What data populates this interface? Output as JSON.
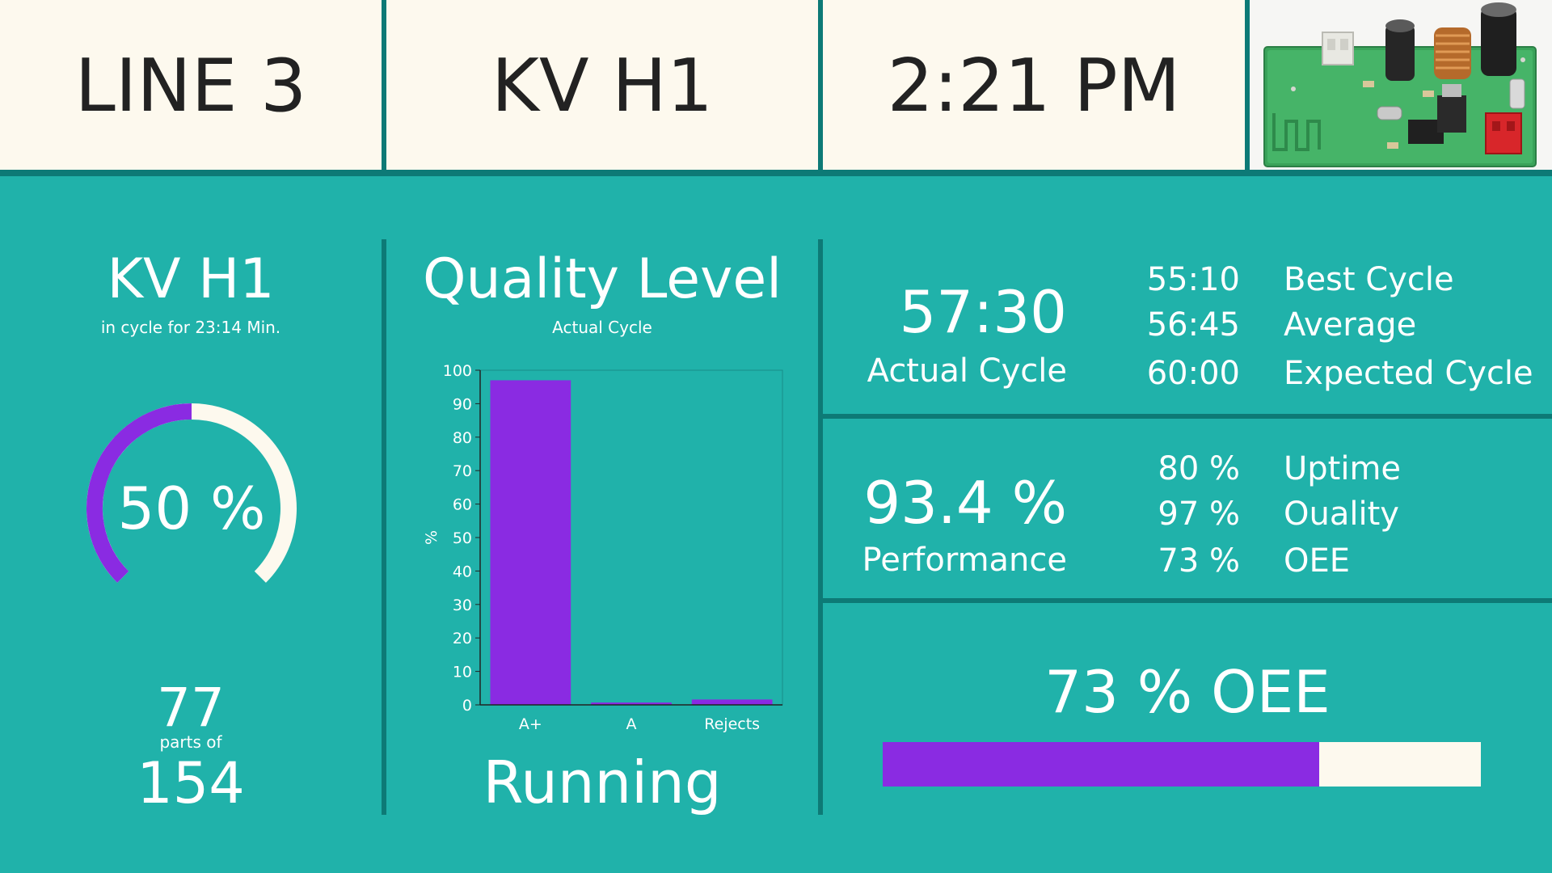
{
  "header": {
    "line": "LINE 3",
    "machine": "KV H1",
    "time": "2:21 PM"
  },
  "machine_panel": {
    "title": "KV H1",
    "subtitle": "in cycle for 23:14 Min.",
    "progress_label": "50 %",
    "progress": 0.5,
    "parts_done": "77",
    "parts_of_label": "parts of",
    "parts_total": "154"
  },
  "quality": {
    "title": "Quality Level",
    "subtitle": "Actual Cycle",
    "status": "Running"
  },
  "chart_data": {
    "type": "bar",
    "categories": [
      "A+",
      "A",
      "Rejects"
    ],
    "values": [
      97,
      0.7,
      1.6
    ],
    "ylabel": "%",
    "ylim": [
      0,
      100
    ],
    "yticks": [
      "0",
      "10",
      "20",
      "30",
      "40",
      "50",
      "60",
      "70",
      "80",
      "90",
      "100"
    ],
    "bar_color": "#8a2be2"
  },
  "cycle": {
    "actual_value": "57:30",
    "actual_label": "Actual Cycle",
    "rows": [
      {
        "value": "55:10",
        "label": "Best Cycle"
      },
      {
        "value": "56:45",
        "label": "Average"
      },
      {
        "value": "60:00",
        "label": "Expected Cycle"
      }
    ]
  },
  "performance": {
    "value": "93.4 %",
    "label": "Performance",
    "rows": [
      {
        "value": "80 %",
        "label": "Uptime"
      },
      {
        "value": "97 %",
        "label": "Ouality"
      },
      {
        "value": "73 %",
        "label": "OEE"
      }
    ]
  },
  "oee": {
    "title": "73 % OEE",
    "fraction": 0.73
  },
  "colors": {
    "background": "#20b2aa",
    "divider": "#0d7a76",
    "accent": "#8a2be2",
    "cream": "#fdf9ee"
  }
}
